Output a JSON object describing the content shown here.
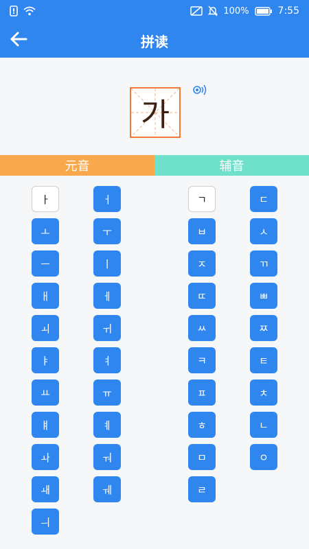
{
  "status_bar": {
    "battery": "100%",
    "time": "7:55"
  },
  "app_bar": {
    "title": "拼读"
  },
  "preview": {
    "character": "가"
  },
  "tabs": [
    {
      "label": "元音",
      "color": "#f9a94c"
    },
    {
      "label": "辅音",
      "color": "#6fe0c9"
    }
  ],
  "vowels": {
    "col1": [
      "ㅏ",
      "ㅗ",
      "ㅡ",
      "ㅐ",
      "ㅚ",
      "ㅑ",
      "ㅛ",
      "ㅒ",
      "ㅘ",
      "ㅙ",
      "ㅢ"
    ],
    "col2": [
      "ㅓ",
      "ㅜ",
      "ㅣ",
      "ㅔ",
      "ㅟ",
      "ㅕ",
      "ㅠ",
      "ㅖ",
      "ㅝ",
      "ㅞ"
    ],
    "selected": "ㅏ"
  },
  "consonants": {
    "col1": [
      "ㄱ",
      "ㅂ",
      "ㅈ",
      "ㄸ",
      "ㅆ",
      "ㅋ",
      "ㅍ",
      "ㅎ",
      "ㅁ",
      "ㄹ"
    ],
    "col2": [
      "ㄷ",
      "ㅅ",
      "ㄲ",
      "ㅃ",
      "ㅉ",
      "ㅌ",
      "ㅊ",
      "ㄴ",
      "ㅇ"
    ],
    "selected": "ㄱ"
  },
  "colors": {
    "primary": "#2f86ef",
    "accent_box": "#ef7a3a"
  },
  "icons": {
    "back": "arrow-left-icon",
    "speaker": "speaker-icon"
  }
}
